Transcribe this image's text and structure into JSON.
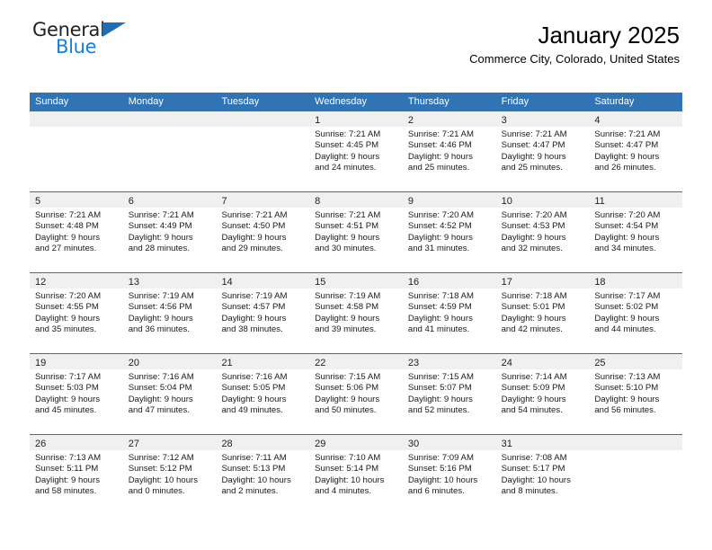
{
  "brand": {
    "name_part1": "General",
    "name_part2": "Blue",
    "triangle_icon": "triangle-icon"
  },
  "header": {
    "title": "January 2025",
    "subtitle": "Commerce City, Colorado, United States"
  },
  "colors": {
    "header_blue": "#2f74b5",
    "logo_blue": "#1b7fd4",
    "daynum_band": "#f0f0f0"
  },
  "weekdays": [
    "Sunday",
    "Monday",
    "Tuesday",
    "Wednesday",
    "Thursday",
    "Friday",
    "Saturday"
  ],
  "weeks": [
    [
      {
        "day": "",
        "sunrise": "",
        "sunset": "",
        "daylight_line1": "",
        "daylight_line2": "",
        "empty": true
      },
      {
        "day": "",
        "sunrise": "",
        "sunset": "",
        "daylight_line1": "",
        "daylight_line2": "",
        "empty": true
      },
      {
        "day": "",
        "sunrise": "",
        "sunset": "",
        "daylight_line1": "",
        "daylight_line2": "",
        "empty": true
      },
      {
        "day": "1",
        "sunrise": "Sunrise: 7:21 AM",
        "sunset": "Sunset: 4:45 PM",
        "daylight_line1": "Daylight: 9 hours",
        "daylight_line2": "and 24 minutes.",
        "empty": false
      },
      {
        "day": "2",
        "sunrise": "Sunrise: 7:21 AM",
        "sunset": "Sunset: 4:46 PM",
        "daylight_line1": "Daylight: 9 hours",
        "daylight_line2": "and 25 minutes.",
        "empty": false
      },
      {
        "day": "3",
        "sunrise": "Sunrise: 7:21 AM",
        "sunset": "Sunset: 4:47 PM",
        "daylight_line1": "Daylight: 9 hours",
        "daylight_line2": "and 25 minutes.",
        "empty": false
      },
      {
        "day": "4",
        "sunrise": "Sunrise: 7:21 AM",
        "sunset": "Sunset: 4:47 PM",
        "daylight_line1": "Daylight: 9 hours",
        "daylight_line2": "and 26 minutes.",
        "empty": false
      }
    ],
    [
      {
        "day": "5",
        "sunrise": "Sunrise: 7:21 AM",
        "sunset": "Sunset: 4:48 PM",
        "daylight_line1": "Daylight: 9 hours",
        "daylight_line2": "and 27 minutes.",
        "empty": false
      },
      {
        "day": "6",
        "sunrise": "Sunrise: 7:21 AM",
        "sunset": "Sunset: 4:49 PM",
        "daylight_line1": "Daylight: 9 hours",
        "daylight_line2": "and 28 minutes.",
        "empty": false
      },
      {
        "day": "7",
        "sunrise": "Sunrise: 7:21 AM",
        "sunset": "Sunset: 4:50 PM",
        "daylight_line1": "Daylight: 9 hours",
        "daylight_line2": "and 29 minutes.",
        "empty": false
      },
      {
        "day": "8",
        "sunrise": "Sunrise: 7:21 AM",
        "sunset": "Sunset: 4:51 PM",
        "daylight_line1": "Daylight: 9 hours",
        "daylight_line2": "and 30 minutes.",
        "empty": false
      },
      {
        "day": "9",
        "sunrise": "Sunrise: 7:20 AM",
        "sunset": "Sunset: 4:52 PM",
        "daylight_line1": "Daylight: 9 hours",
        "daylight_line2": "and 31 minutes.",
        "empty": false
      },
      {
        "day": "10",
        "sunrise": "Sunrise: 7:20 AM",
        "sunset": "Sunset: 4:53 PM",
        "daylight_line1": "Daylight: 9 hours",
        "daylight_line2": "and 32 minutes.",
        "empty": false
      },
      {
        "day": "11",
        "sunrise": "Sunrise: 7:20 AM",
        "sunset": "Sunset: 4:54 PM",
        "daylight_line1": "Daylight: 9 hours",
        "daylight_line2": "and 34 minutes.",
        "empty": false
      }
    ],
    [
      {
        "day": "12",
        "sunrise": "Sunrise: 7:20 AM",
        "sunset": "Sunset: 4:55 PM",
        "daylight_line1": "Daylight: 9 hours",
        "daylight_line2": "and 35 minutes.",
        "empty": false
      },
      {
        "day": "13",
        "sunrise": "Sunrise: 7:19 AM",
        "sunset": "Sunset: 4:56 PM",
        "daylight_line1": "Daylight: 9 hours",
        "daylight_line2": "and 36 minutes.",
        "empty": false
      },
      {
        "day": "14",
        "sunrise": "Sunrise: 7:19 AM",
        "sunset": "Sunset: 4:57 PM",
        "daylight_line1": "Daylight: 9 hours",
        "daylight_line2": "and 38 minutes.",
        "empty": false
      },
      {
        "day": "15",
        "sunrise": "Sunrise: 7:19 AM",
        "sunset": "Sunset: 4:58 PM",
        "daylight_line1": "Daylight: 9 hours",
        "daylight_line2": "and 39 minutes.",
        "empty": false
      },
      {
        "day": "16",
        "sunrise": "Sunrise: 7:18 AM",
        "sunset": "Sunset: 4:59 PM",
        "daylight_line1": "Daylight: 9 hours",
        "daylight_line2": "and 41 minutes.",
        "empty": false
      },
      {
        "day": "17",
        "sunrise": "Sunrise: 7:18 AM",
        "sunset": "Sunset: 5:01 PM",
        "daylight_line1": "Daylight: 9 hours",
        "daylight_line2": "and 42 minutes.",
        "empty": false
      },
      {
        "day": "18",
        "sunrise": "Sunrise: 7:17 AM",
        "sunset": "Sunset: 5:02 PM",
        "daylight_line1": "Daylight: 9 hours",
        "daylight_line2": "and 44 minutes.",
        "empty": false
      }
    ],
    [
      {
        "day": "19",
        "sunrise": "Sunrise: 7:17 AM",
        "sunset": "Sunset: 5:03 PM",
        "daylight_line1": "Daylight: 9 hours",
        "daylight_line2": "and 45 minutes.",
        "empty": false
      },
      {
        "day": "20",
        "sunrise": "Sunrise: 7:16 AM",
        "sunset": "Sunset: 5:04 PM",
        "daylight_line1": "Daylight: 9 hours",
        "daylight_line2": "and 47 minutes.",
        "empty": false
      },
      {
        "day": "21",
        "sunrise": "Sunrise: 7:16 AM",
        "sunset": "Sunset: 5:05 PM",
        "daylight_line1": "Daylight: 9 hours",
        "daylight_line2": "and 49 minutes.",
        "empty": false
      },
      {
        "day": "22",
        "sunrise": "Sunrise: 7:15 AM",
        "sunset": "Sunset: 5:06 PM",
        "daylight_line1": "Daylight: 9 hours",
        "daylight_line2": "and 50 minutes.",
        "empty": false
      },
      {
        "day": "23",
        "sunrise": "Sunrise: 7:15 AM",
        "sunset": "Sunset: 5:07 PM",
        "daylight_line1": "Daylight: 9 hours",
        "daylight_line2": "and 52 minutes.",
        "empty": false
      },
      {
        "day": "24",
        "sunrise": "Sunrise: 7:14 AM",
        "sunset": "Sunset: 5:09 PM",
        "daylight_line1": "Daylight: 9 hours",
        "daylight_line2": "and 54 minutes.",
        "empty": false
      },
      {
        "day": "25",
        "sunrise": "Sunrise: 7:13 AM",
        "sunset": "Sunset: 5:10 PM",
        "daylight_line1": "Daylight: 9 hours",
        "daylight_line2": "and 56 minutes.",
        "empty": false
      }
    ],
    [
      {
        "day": "26",
        "sunrise": "Sunrise: 7:13 AM",
        "sunset": "Sunset: 5:11 PM",
        "daylight_line1": "Daylight: 9 hours",
        "daylight_line2": "and 58 minutes.",
        "empty": false
      },
      {
        "day": "27",
        "sunrise": "Sunrise: 7:12 AM",
        "sunset": "Sunset: 5:12 PM",
        "daylight_line1": "Daylight: 10 hours",
        "daylight_line2": "and 0 minutes.",
        "empty": false
      },
      {
        "day": "28",
        "sunrise": "Sunrise: 7:11 AM",
        "sunset": "Sunset: 5:13 PM",
        "daylight_line1": "Daylight: 10 hours",
        "daylight_line2": "and 2 minutes.",
        "empty": false
      },
      {
        "day": "29",
        "sunrise": "Sunrise: 7:10 AM",
        "sunset": "Sunset: 5:14 PM",
        "daylight_line1": "Daylight: 10 hours",
        "daylight_line2": "and 4 minutes.",
        "empty": false
      },
      {
        "day": "30",
        "sunrise": "Sunrise: 7:09 AM",
        "sunset": "Sunset: 5:16 PM",
        "daylight_line1": "Daylight: 10 hours",
        "daylight_line2": "and 6 minutes.",
        "empty": false
      },
      {
        "day": "31",
        "sunrise": "Sunrise: 7:08 AM",
        "sunset": "Sunset: 5:17 PM",
        "daylight_line1": "Daylight: 10 hours",
        "daylight_line2": "and 8 minutes.",
        "empty": false
      },
      {
        "day": "",
        "sunrise": "",
        "sunset": "",
        "daylight_line1": "",
        "daylight_line2": "",
        "empty": true
      }
    ]
  ]
}
